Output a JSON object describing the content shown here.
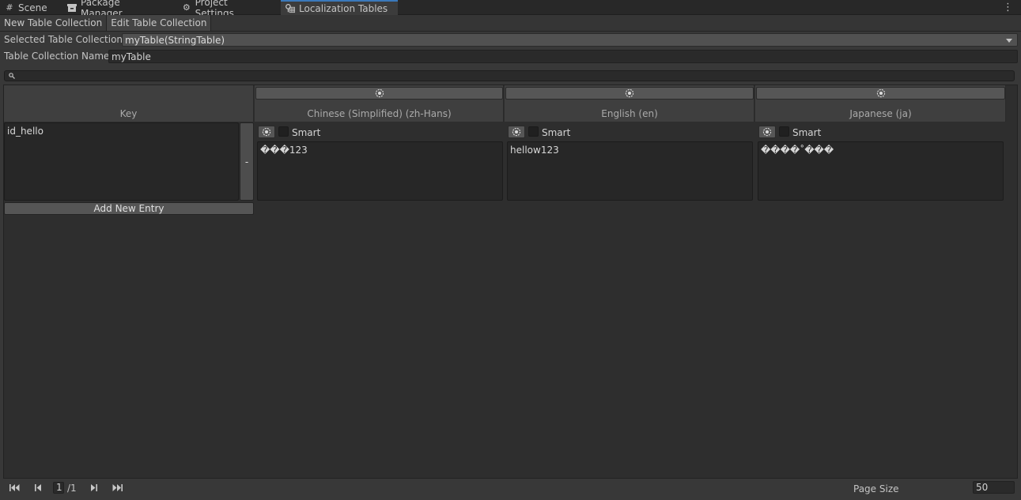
{
  "tabs": [
    {
      "label": "Scene",
      "icon": "grid-icon"
    },
    {
      "label": "Package Manager",
      "icon": "package-icon"
    },
    {
      "label": "Project Settings",
      "icon": "gear-icon"
    },
    {
      "label": "Localization Tables",
      "icon": "localization-tables-icon"
    }
  ],
  "toolbar": {
    "new_label": "New Table Collection",
    "edit_label": "Edit Table Collection"
  },
  "selected_collection": {
    "label": "Selected Table Collection",
    "value": "myTable(StringTable)"
  },
  "collection_name": {
    "label": "Table Collection Name",
    "value": "myTable"
  },
  "search": {
    "placeholder": ""
  },
  "table": {
    "key_header": "Key",
    "columns": [
      {
        "name": "Chinese (Simplified) (zh-Hans)"
      },
      {
        "name": "English (en)"
      },
      {
        "name": "Japanese (ja)"
      }
    ],
    "rows": [
      {
        "key": "id_hello",
        "remove_label": "-",
        "cells": [
          {
            "smart_label": "Smart",
            "smart": false,
            "value": "���123"
          },
          {
            "smart_label": "Smart",
            "smart": false,
            "value": "hellow123"
          },
          {
            "smart_label": "Smart",
            "smart": false,
            "value": "����˚���"
          }
        ]
      }
    ],
    "add_entry_label": "Add New Entry"
  },
  "footer": {
    "page_current": "1",
    "page_total": "/1",
    "page_size_label": "Page Size",
    "page_size_value": "50"
  }
}
